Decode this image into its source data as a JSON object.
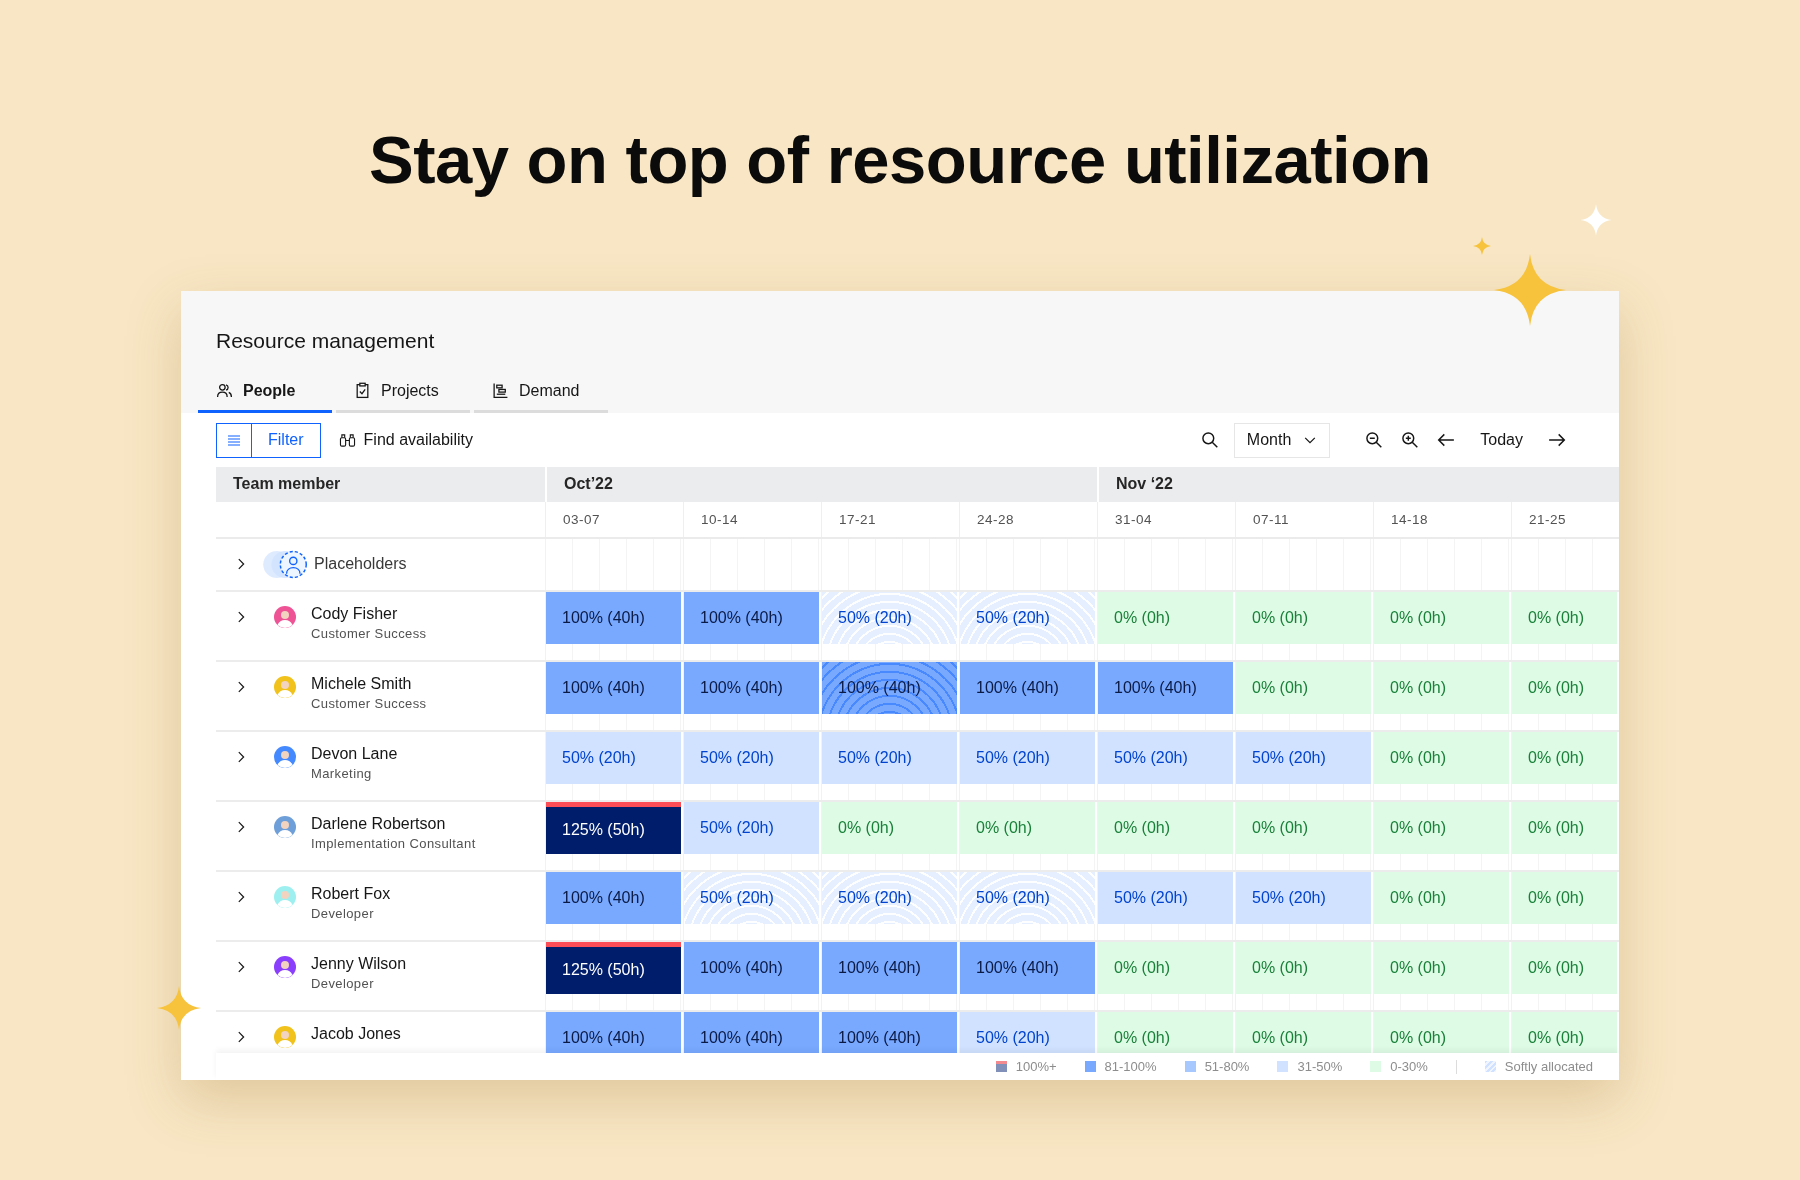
{
  "headline": "Stay on top of resource utilization",
  "app": {
    "title": "Resource management",
    "tabs": [
      {
        "label": "People",
        "selected": true
      },
      {
        "label": "Projects",
        "selected": false
      },
      {
        "label": "Demand",
        "selected": false
      }
    ],
    "toolbar": {
      "filter": "Filter",
      "find": "Find availability",
      "view": "Month",
      "today": "Today"
    },
    "table": {
      "member_header": "Team member",
      "months": [
        {
          "label": "Oct’22",
          "weeks": [
            "03-07",
            "10-14",
            "17-21",
            "24-28"
          ]
        },
        {
          "label": "Nov ‘22",
          "weeks": [
            "31-04",
            "07-11",
            "14-18",
            "21-25"
          ]
        }
      ],
      "rows": [
        {
          "kind": "placeholder",
          "name": "Placeholders"
        },
        {
          "kind": "person",
          "name": "Cody Fisher",
          "role": "Customer Success",
          "color": "#ee5396",
          "cells": [
            {
              "label": "100% (40h)",
              "kind": "full",
              "soft": false
            },
            {
              "label": "100% (40h)",
              "kind": "full",
              "soft": false
            },
            {
              "label": "50% (20h)",
              "kind": "half",
              "soft": true
            },
            {
              "label": "50% (20h)",
              "kind": "half",
              "soft": true
            },
            {
              "label": "0% (0h)",
              "kind": "zero",
              "soft": false
            },
            {
              "label": "0% (0h)",
              "kind": "zero",
              "soft": false
            },
            {
              "label": "0% (0h)",
              "kind": "zero",
              "soft": false
            },
            {
              "label": "0% (0h)",
              "kind": "zero",
              "soft": false
            }
          ]
        },
        {
          "kind": "person",
          "name": "Michele Smith",
          "role": "Customer Success",
          "color": "#f1c21b",
          "cells": [
            {
              "label": "100% (40h)",
              "kind": "full",
              "soft": false
            },
            {
              "label": "100% (40h)",
              "kind": "full",
              "soft": false
            },
            {
              "label": "100% (40h)",
              "kind": "full",
              "soft": true
            },
            {
              "label": "100% (40h)",
              "kind": "full",
              "soft": false
            },
            {
              "label": "100% (40h)",
              "kind": "full",
              "soft": false
            },
            {
              "label": "0% (0h)",
              "kind": "zero",
              "soft": false
            },
            {
              "label": "0% (0h)",
              "kind": "zero",
              "soft": false
            },
            {
              "label": "0% (0h)",
              "kind": "zero",
              "soft": false
            }
          ]
        },
        {
          "kind": "person",
          "name": "Devon Lane",
          "role": "Marketing",
          "color": "#4589ff",
          "cells": [
            {
              "label": "50% (20h)",
              "kind": "half",
              "soft": false
            },
            {
              "label": "50% (20h)",
              "kind": "half",
              "soft": false
            },
            {
              "label": "50% (20h)",
              "kind": "half",
              "soft": false
            },
            {
              "label": "50% (20h)",
              "kind": "half",
              "soft": false
            },
            {
              "label": "50% (20h)",
              "kind": "half",
              "soft": false
            },
            {
              "label": "50% (20h)",
              "kind": "half",
              "soft": false
            },
            {
              "label": "0% (0h)",
              "kind": "zero",
              "soft": false
            },
            {
              "label": "0% (0h)",
              "kind": "zero",
              "soft": false
            }
          ]
        },
        {
          "kind": "person",
          "name": "Darlene Robertson",
          "role": "Implementation Consultant",
          "color": "#6f9fd8",
          "cells": [
            {
              "label": "125% (50h)",
              "kind": "over",
              "soft": false
            },
            {
              "label": "50% (20h)",
              "kind": "half",
              "soft": false
            },
            {
              "label": "0% (0h)",
              "kind": "zero",
              "soft": false
            },
            {
              "label": "0% (0h)",
              "kind": "zero",
              "soft": false
            },
            {
              "label": "0% (0h)",
              "kind": "zero",
              "soft": false
            },
            {
              "label": "0% (0h)",
              "kind": "zero",
              "soft": false
            },
            {
              "label": "0% (0h)",
              "kind": "zero",
              "soft": false
            },
            {
              "label": "0% (0h)",
              "kind": "zero",
              "soft": false
            }
          ]
        },
        {
          "kind": "person",
          "name": "Robert Fox",
          "role": "Developer",
          "color": "#9ef0f0",
          "cells": [
            {
              "label": "100% (40h)",
              "kind": "full",
              "soft": false
            },
            {
              "label": "50% (20h)",
              "kind": "half",
              "soft": true
            },
            {
              "label": "50% (20h)",
              "kind": "half",
              "soft": true
            },
            {
              "label": "50% (20h)",
              "kind": "half",
              "soft": true
            },
            {
              "label": "50% (20h)",
              "kind": "half",
              "soft": false
            },
            {
              "label": "50% (20h)",
              "kind": "half",
              "soft": false
            },
            {
              "label": "0% (0h)",
              "kind": "zero",
              "soft": false
            },
            {
              "label": "0% (0h)",
              "kind": "zero",
              "soft": false
            }
          ]
        },
        {
          "kind": "person",
          "name": "Jenny Wilson",
          "role": "Developer",
          "color": "#8a3ffc",
          "cells": [
            {
              "label": "125% (50h)",
              "kind": "over",
              "soft": false
            },
            {
              "label": "100% (40h)",
              "kind": "full",
              "soft": false
            },
            {
              "label": "100% (40h)",
              "kind": "full",
              "soft": false
            },
            {
              "label": "100% (40h)",
              "kind": "full",
              "soft": false
            },
            {
              "label": "0% (0h)",
              "kind": "zero",
              "soft": false
            },
            {
              "label": "0% (0h)",
              "kind": "zero",
              "soft": false
            },
            {
              "label": "0% (0h)",
              "kind": "zero",
              "soft": false
            },
            {
              "label": "0% (0h)",
              "kind": "zero",
              "soft": false
            }
          ]
        },
        {
          "kind": "person",
          "name": "Jacob Jones",
          "color": "#f1c21b",
          "cells": [
            {
              "label": "100% (40h)",
              "kind": "full",
              "soft": false
            },
            {
              "label": "100% (40h)",
              "kind": "full",
              "soft": false
            },
            {
              "label": "100% (40h)",
              "kind": "full",
              "soft": false
            },
            {
              "label": "50% (20h)",
              "kind": "half",
              "soft": false
            },
            {
              "label": "0% (0h)",
              "kind": "zero",
              "soft": false
            },
            {
              "label": "0% (0h)",
              "kind": "zero",
              "soft": false
            },
            {
              "label": "0% (0h)",
              "kind": "zero",
              "soft": false
            },
            {
              "label": "0% (0h)",
              "kind": "zero",
              "soft": false
            }
          ]
        }
      ]
    },
    "legend": [
      {
        "kind": "over",
        "label": "100%+"
      },
      {
        "kind": "full",
        "label": "81-100%"
      },
      {
        "kind": "high",
        "label": "51-80%"
      },
      {
        "kind": "half",
        "label": "31-50%"
      },
      {
        "kind": "zero",
        "label": "0-30%"
      },
      {
        "kind": "soft",
        "label": "Softly allocated"
      }
    ]
  }
}
